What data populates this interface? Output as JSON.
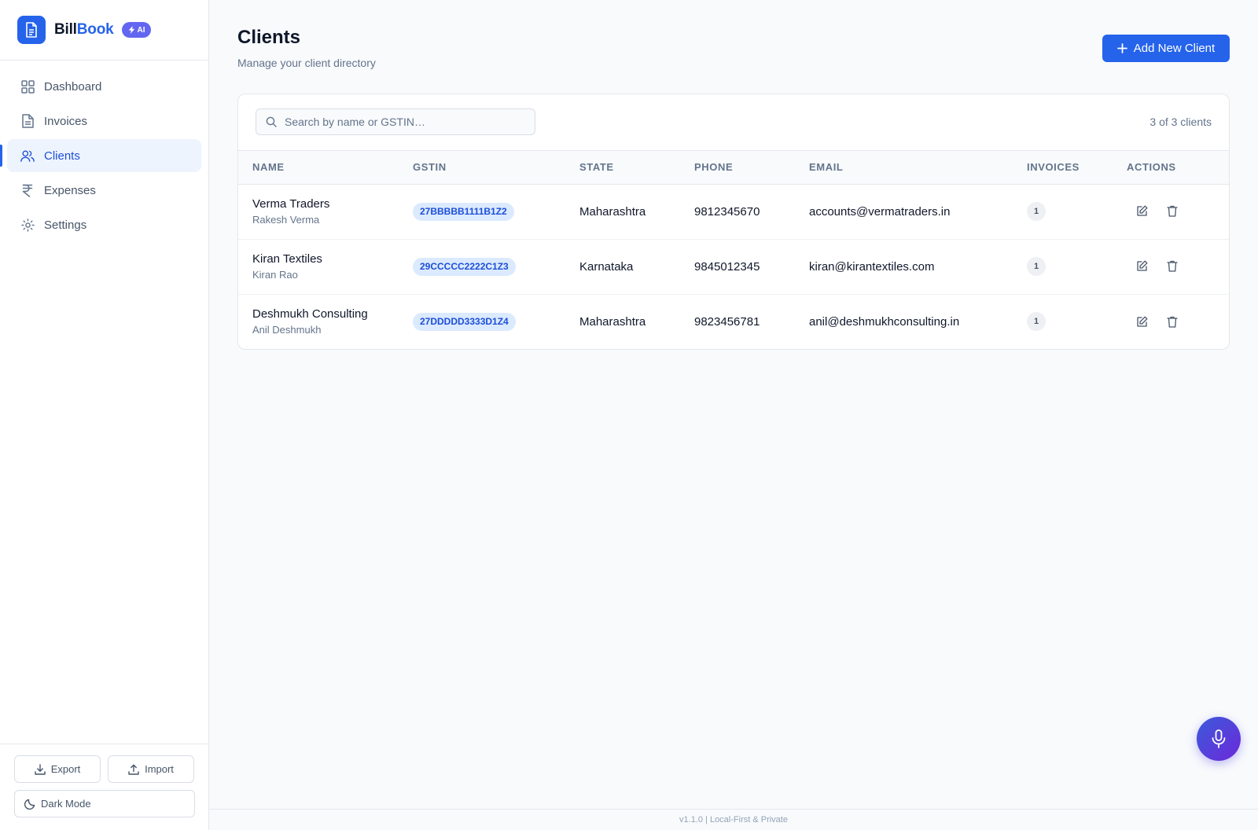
{
  "brand": {
    "name_part1": "Bill",
    "name_part2": "Book",
    "badge": "AI"
  },
  "nav": [
    {
      "label": "Dashboard",
      "icon": "dashboard-icon",
      "active": false
    },
    {
      "label": "Invoices",
      "icon": "invoice-icon",
      "active": false
    },
    {
      "label": "Clients",
      "icon": "users-icon",
      "active": true
    },
    {
      "label": "Expenses",
      "icon": "rupee-icon",
      "active": false
    },
    {
      "label": "Settings",
      "icon": "gear-icon",
      "active": false
    }
  ],
  "sidebar_bottom": {
    "export_label": "Export",
    "import_label": "Import",
    "dark_mode_label": "Dark Mode"
  },
  "page": {
    "title": "Clients",
    "subtitle": "Manage your client directory",
    "add_button": "Add New Client"
  },
  "search": {
    "placeholder": "Search by name or GSTIN…",
    "count_text": "3 of 3 clients"
  },
  "table": {
    "columns": [
      "NAME",
      "GSTIN",
      "STATE",
      "PHONE",
      "EMAIL",
      "INVOICES",
      "ACTIONS"
    ],
    "rows": [
      {
        "name": "Verma Traders",
        "contact": "Rakesh Verma",
        "gstin": "27BBBBB1111B1Z2",
        "state": "Maharashtra",
        "phone": "9812345670",
        "email": "accounts@vermatraders.in",
        "invoices": "1"
      },
      {
        "name": "Kiran Textiles",
        "contact": "Kiran Rao",
        "gstin": "29CCCCC2222C1Z3",
        "state": "Karnataka",
        "phone": "9845012345",
        "email": "kiran@kirantextiles.com",
        "invoices": "1"
      },
      {
        "name": "Deshmukh Consulting",
        "contact": "Anil Deshmukh",
        "gstin": "27DDDDD3333D1Z4",
        "state": "Maharashtra",
        "phone": "9823456781",
        "email": "anil@deshmukhconsulting.in",
        "invoices": "1"
      }
    ]
  },
  "footer": {
    "text": "v1.1.0 | Local-First & Private"
  },
  "colors": {
    "accent": "#2563eb",
    "ai_badge": "#6366f1",
    "gstin_bg": "#dbeafe",
    "mic_gradient_start": "#3b5bdb",
    "mic_gradient_end": "#6d28d9"
  }
}
